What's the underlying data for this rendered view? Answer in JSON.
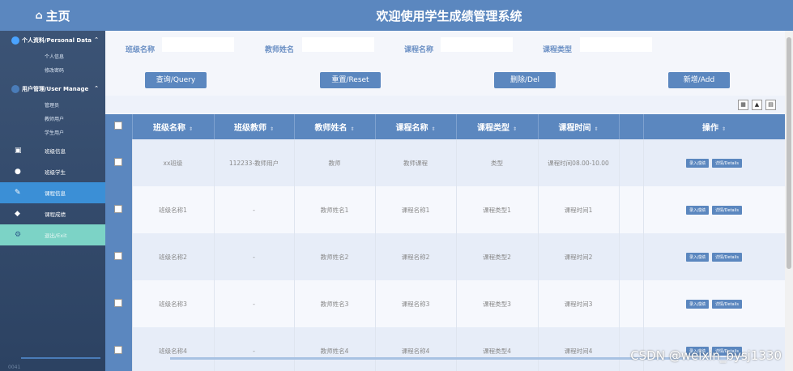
{
  "sidebar": {
    "home_label": "主页",
    "personal_section": "个人资料/Personal Data",
    "personal_items": [
      "个人信息",
      "修改密码"
    ],
    "user_section": "用户管理/User Manage",
    "user_items": [
      "管理员",
      "教师用户",
      "学生用户"
    ],
    "menu_items": [
      "班级信息",
      "班级学生",
      "课程信息",
      "课程成绩",
      "退出/Exit"
    ],
    "footer_text": "0041"
  },
  "header": {
    "title": "欢迎使用学生成绩管理系统"
  },
  "search": {
    "class_name_label": "班级名称",
    "teacher_name_label": "教师姓名",
    "course_name_label": "课程名称",
    "course_type_label": "课程类型"
  },
  "actions": {
    "query": "查询/Query",
    "reset": "重置/Reset",
    "delete": "删除/Del",
    "add": "新增/Add"
  },
  "table": {
    "columns": [
      "班级名称",
      "班级教师",
      "教师姓名",
      "课程名称",
      "课程类型",
      "课程时间",
      "操作"
    ],
    "rows": [
      {
        "class_name": "xx班级",
        "class_teacher": "112233-教师用户",
        "teacher_name": "教师",
        "course_name": "教师课程",
        "course_type": "类型",
        "course_time": "课程时间08.00-10.00"
      },
      {
        "class_name": "班级名称1",
        "class_teacher": "-",
        "teacher_name": "教师姓名1",
        "course_name": "课程名称1",
        "course_type": "课程类型1",
        "course_time": "课程时间1"
      },
      {
        "class_name": "班级名称2",
        "class_teacher": "-",
        "teacher_name": "教师姓名2",
        "course_name": "课程名称2",
        "course_type": "课程类型2",
        "course_time": "课程时间2"
      },
      {
        "class_name": "班级名称3",
        "class_teacher": "-",
        "teacher_name": "教师姓名3",
        "course_name": "课程名称3",
        "course_type": "课程类型3",
        "course_time": "课程时间3"
      },
      {
        "class_name": "班级名称4",
        "class_teacher": "-",
        "teacher_name": "教师姓名4",
        "course_name": "课程名称4",
        "course_type": "课程类型4",
        "course_time": "课程时间4"
      }
    ],
    "row_action_score": "录入成绩",
    "row_action_detail": "详情/Details"
  },
  "watermark": "CSDN @weixin_bysj1330",
  "colors": {
    "primary": "#5b87bf",
    "sidebar": "#34496a",
    "active": "#3b8fd6",
    "exit": "#7cd3c6"
  }
}
